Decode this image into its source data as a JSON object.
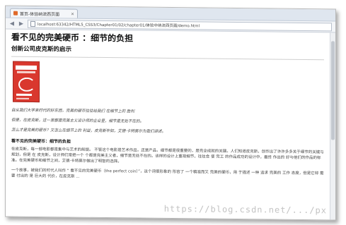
{
  "browser": {
    "tab_title": "首页-体验纳流西页面",
    "tab_close": "×",
    "back": "◀",
    "forward": "▶",
    "url": "localhost:63342/HTML5_CSS3/Chapter01/02/chapter01/体验中纳流西页面/demo.html"
  },
  "article": {
    "title": "看不见的完美硬币 ：细节的负担",
    "subtitle": "创新公司皮克斯的启示",
    "intro": [
      "自从我们大学来时代的好东西，完美的硬币往往给我们 在细节上的 胜利",
      "但是，在皮克斯，这一家都是完美主义设计师的企业里，细节是无处不在的。",
      "怎么才是完美的硬币？又怎么在细节上的 利益，皮克斯毕如，艾德·卡特莫尔为我们讲述。"
    ],
    "section_title": "看不见的完美硬币：细节的负担",
    "body": [
      "在皮克斯，每一部电影都是集中与艺术的前提。 不管这个电影是艺术作品，还是产品，细节都是很重要的，是完全成就的关键。人们知道皮克斯，创作出了许许多多关于细节的关键与规划，但是 在 皮克斯，设计师们常把一个 个都是完美主义者，细节是无处不在的。该样的设计上重视细节，往往会 使 完工 的作品成功的设计中，最终 作出的 好与他们的作品的标准。在完美硬币和细节之间，艾德·卡特莫尔做出了明智的选择。",
      "一个故事，被我们的时代人叫作 “ 看不见的完美硬币（the perfect coin）”，这个词很形象的 形容了 一个精准而又 完美的硬币，用 于描述 一种 追求 完美的 工作 态度，但是它却 需要 付出的 是 巨大的 代价，在皮克斯 ..."
    ]
  },
  "watermark": "https://blog.csdn.net/.../px"
}
